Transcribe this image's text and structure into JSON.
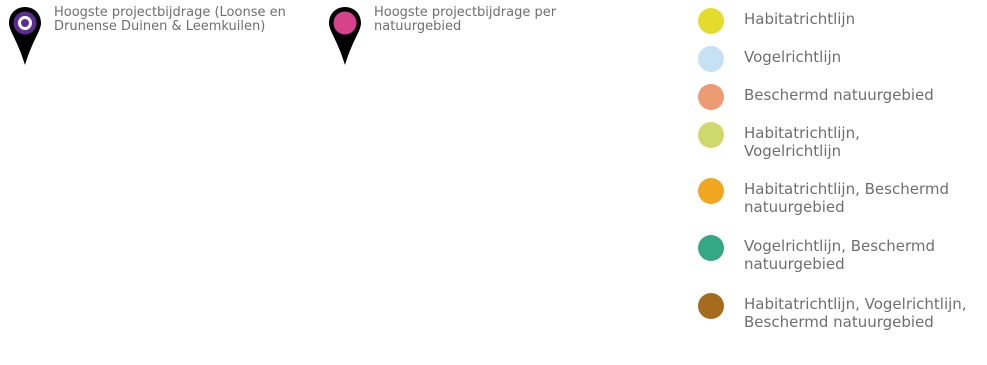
{
  "markers": [
    {
      "label": "Hoogste projectbijdrage (Loonse en Drunense Duinen & Leemkuilen)",
      "color": "#5b2d90",
      "icon": "map-pin-ring-icon"
    },
    {
      "label": "Hoogste projectbijdrage per natuurgebied",
      "color": "#d6428c",
      "icon": "map-pin-filled-icon"
    }
  ],
  "legend": [
    {
      "label": "Habitatrichtlijn",
      "color": "#e3dc2b"
    },
    {
      "label": "Vogelrichtlijn",
      "color": "#c6e1f3"
    },
    {
      "label": "Beschermd natuurgebied",
      "color": "#ec9b72"
    },
    {
      "label": "Habitatrichtlijn, Vogelrichtlijn",
      "color": "#cfd86a"
    },
    {
      "label": "Habitatrichtlijn, Beschermd natuurgebied",
      "color": "#f0a61e"
    },
    {
      "label": "Vogelrichtlijn, Beschermd natuurgebied",
      "color": "#34a883"
    },
    {
      "label": "Habitatrichtlijn, Vogelrichtlijn, Beschermd natuurgebied",
      "color": "#a46c1c"
    }
  ]
}
